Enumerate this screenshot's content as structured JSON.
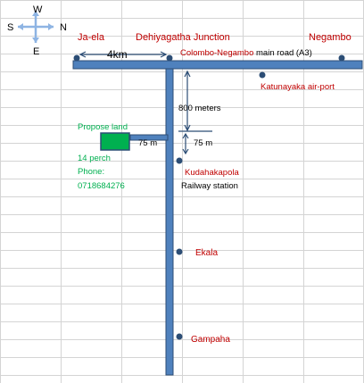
{
  "colors": {
    "grid": "#d4d4d4",
    "road_fill": "#4f81bd",
    "road_stroke": "#2c4d75",
    "dot": "#2c4d75",
    "red_label": "#c00000",
    "land_fill": "#00b050",
    "land_text": "#00b050",
    "text": "#000000",
    "compass": "#8eb4e3"
  },
  "compass": {
    "north": "N",
    "south": "S",
    "east": "E",
    "west": "W"
  },
  "places": {
    "jaela": "Ja-ela",
    "dehiyagatha": "Dehiyagatha Junction",
    "negambo": "Negambo",
    "katunayaka": "Katunayaka air-port",
    "kudahakapola": "Kudahakapola",
    "railway_station": "Railway station",
    "ekala": "Ekala",
    "gampaha": "Gampaha"
  },
  "main_road": {
    "name": "Colombo-Negambo",
    "suffix": " main road (A3)"
  },
  "distances": {
    "jaela_to_junction": "4km",
    "junction_to_lane": "800 meters",
    "lane_length": "75 m",
    "lane_to_station": "75 m"
  },
  "land": {
    "title": "Propose land",
    "size": "14 perch",
    "phone_label": "Phone:",
    "phone": "0718684276"
  }
}
